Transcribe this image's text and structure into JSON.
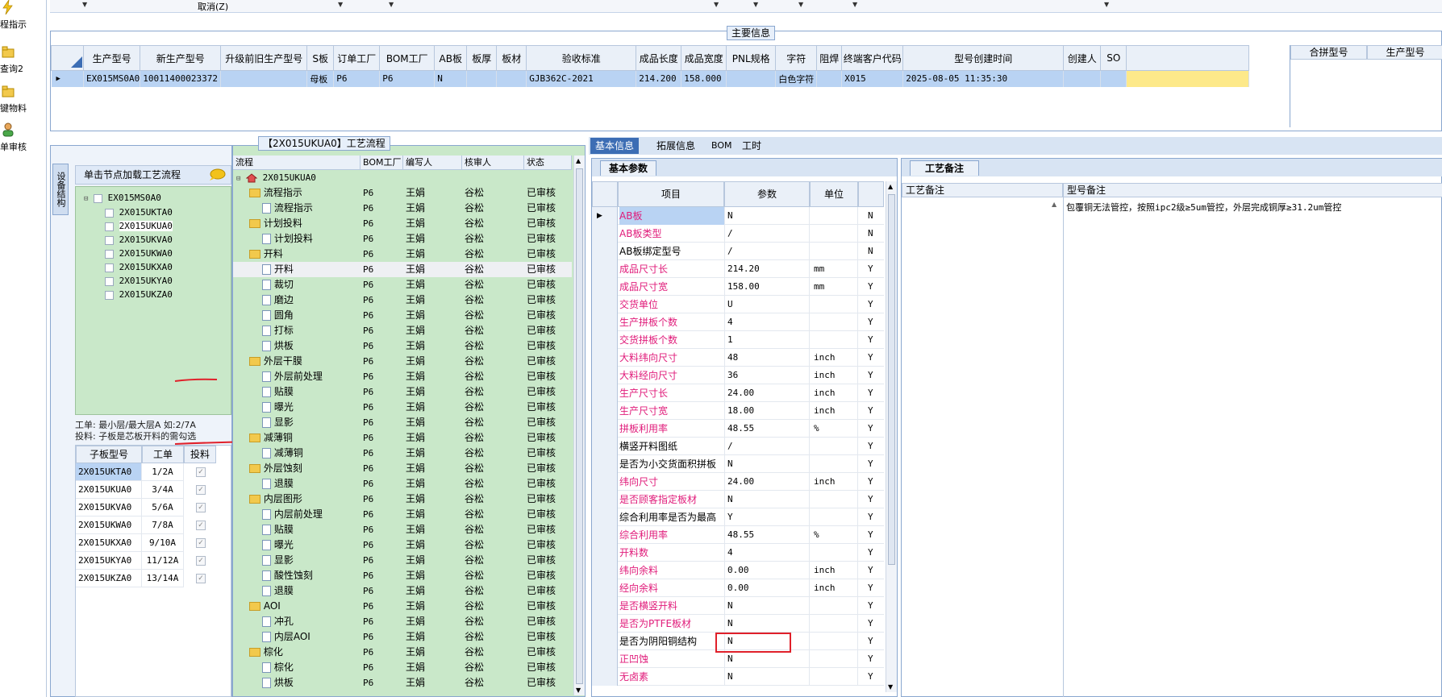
{
  "rail": {
    "items": [
      {
        "label": "程指示"
      },
      {
        "label": "查询2"
      },
      {
        "label": "键物料"
      },
      {
        "label": "单审核"
      }
    ]
  },
  "topbar": {
    "cancel_label": "取消(Z)"
  },
  "main_info": {
    "title": "主要信息",
    "columns": [
      "生产型号",
      "新生产型号",
      "升级前旧生产型号",
      "S板",
      "订单工厂",
      "BOM工厂",
      "AB板",
      "板厚",
      "板材",
      "验收标准",
      "成品长度",
      "成品宽度",
      "PNL规格",
      "字符",
      "阻焊",
      "终端客户代码",
      "型号创建时间",
      "创建人",
      "SO"
    ],
    "row": [
      "EX015MS0A0",
      "10011400023372",
      "",
      "母板",
      "P6",
      "P6",
      "N",
      "",
      "",
      "GJB362C-2021",
      "214.200",
      "158.000",
      "",
      "白色字符",
      "",
      "X015",
      "2025-08-05 11:35:30",
      "",
      ""
    ],
    "right_columns": [
      "合拼型号",
      "生产型号"
    ]
  },
  "left_panel": {
    "side_tab": "设备结构",
    "header": "单击节点加载工艺流程",
    "tree_root": "EX015MS0A0",
    "tree_children": [
      "2X015UKTA0",
      "2X015UKUA0",
      "2X015UKVA0",
      "2X015UKWA0",
      "2X015UKXA0",
      "2X015UKYA0",
      "2X015UKZA0"
    ],
    "note_line1": "工单: 最小层/最大层A 如:2/7A",
    "note_line2": "投料: 子板是芯板开料的需勾选",
    "sub_columns": [
      "子板型号",
      "工单",
      "投料"
    ],
    "sub_rows": [
      {
        "model": "2X015UKTA0",
        "order": "1/2A"
      },
      {
        "model": "2X015UKUA0",
        "order": "3/4A"
      },
      {
        "model": "2X015UKVA0",
        "order": "5/6A"
      },
      {
        "model": "2X015UKWA0",
        "order": "7/8A"
      },
      {
        "model": "2X015UKXA0",
        "order": "9/10A"
      },
      {
        "model": "2X015UKYA0",
        "order": "11/12A"
      },
      {
        "model": "2X015UKZA0",
        "order": "13/14A"
      }
    ]
  },
  "process": {
    "title": "【2X015UKUA0】工艺流程",
    "columns": [
      "流程",
      "BOM工厂",
      "编写人",
      "核审人",
      "状态"
    ],
    "root": "2X015UKUA0",
    "rows": [
      {
        "name": "流程指示",
        "lvl": 1,
        "factory": "P6",
        "writer": "王娟",
        "reviewer": "谷松",
        "status": "已审核"
      },
      {
        "name": "流程指示",
        "lvl": 2,
        "factory": "P6",
        "writer": "王娟",
        "reviewer": "谷松",
        "status": "已审核"
      },
      {
        "name": "计划投料",
        "lvl": 1,
        "factory": "P6",
        "writer": "王娟",
        "reviewer": "谷松",
        "status": "已审核"
      },
      {
        "name": "计划投料",
        "lvl": 2,
        "factory": "P6",
        "writer": "王娟",
        "reviewer": "谷松",
        "status": "已审核"
      },
      {
        "name": "开料",
        "lvl": 1,
        "factory": "P6",
        "writer": "王娟",
        "reviewer": "谷松",
        "status": "已审核"
      },
      {
        "name": "开料",
        "lvl": 2,
        "factory": "P6",
        "writer": "王娟",
        "reviewer": "谷松",
        "status": "已审核"
      },
      {
        "name": "裁切",
        "lvl": 2,
        "factory": "P6",
        "writer": "王娟",
        "reviewer": "谷松",
        "status": "已审核"
      },
      {
        "name": "磨边",
        "lvl": 2,
        "factory": "P6",
        "writer": "王娟",
        "reviewer": "谷松",
        "status": "已审核"
      },
      {
        "name": "圆角",
        "lvl": 2,
        "factory": "P6",
        "writer": "王娟",
        "reviewer": "谷松",
        "status": "已审核"
      },
      {
        "name": "打标",
        "lvl": 2,
        "factory": "P6",
        "writer": "王娟",
        "reviewer": "谷松",
        "status": "已审核"
      },
      {
        "name": "烘板",
        "lvl": 2,
        "factory": "P6",
        "writer": "王娟",
        "reviewer": "谷松",
        "status": "已审核"
      },
      {
        "name": "外层干膜",
        "lvl": 1,
        "factory": "P6",
        "writer": "王娟",
        "reviewer": "谷松",
        "status": "已审核"
      },
      {
        "name": "外层前处理",
        "lvl": 2,
        "factory": "P6",
        "writer": "王娟",
        "reviewer": "谷松",
        "status": "已审核"
      },
      {
        "name": "贴膜",
        "lvl": 2,
        "factory": "P6",
        "writer": "王娟",
        "reviewer": "谷松",
        "status": "已审核"
      },
      {
        "name": "曝光",
        "lvl": 2,
        "factory": "P6",
        "writer": "王娟",
        "reviewer": "谷松",
        "status": "已审核"
      },
      {
        "name": "显影",
        "lvl": 2,
        "factory": "P6",
        "writer": "王娟",
        "reviewer": "谷松",
        "status": "已审核"
      },
      {
        "name": "减薄铜",
        "lvl": 1,
        "factory": "P6",
        "writer": "王娟",
        "reviewer": "谷松",
        "status": "已审核"
      },
      {
        "name": "减薄铜",
        "lvl": 2,
        "factory": "P6",
        "writer": "王娟",
        "reviewer": "谷松",
        "status": "已审核"
      },
      {
        "name": "外层蚀刻",
        "lvl": 1,
        "factory": "P6",
        "writer": "王娟",
        "reviewer": "谷松",
        "status": "已审核"
      },
      {
        "name": "退膜",
        "lvl": 2,
        "factory": "P6",
        "writer": "王娟",
        "reviewer": "谷松",
        "status": "已审核"
      },
      {
        "name": "内层图形",
        "lvl": 1,
        "factory": "P6",
        "writer": "王娟",
        "reviewer": "谷松",
        "status": "已审核"
      },
      {
        "name": "内层前处理",
        "lvl": 2,
        "factory": "P6",
        "writer": "王娟",
        "reviewer": "谷松",
        "status": "已审核"
      },
      {
        "name": "贴膜",
        "lvl": 2,
        "factory": "P6",
        "writer": "王娟",
        "reviewer": "谷松",
        "status": "已审核"
      },
      {
        "name": "曝光",
        "lvl": 2,
        "factory": "P6",
        "writer": "王娟",
        "reviewer": "谷松",
        "status": "已审核"
      },
      {
        "name": "显影",
        "lvl": 2,
        "factory": "P6",
        "writer": "王娟",
        "reviewer": "谷松",
        "status": "已审核"
      },
      {
        "name": "酸性蚀刻",
        "lvl": 2,
        "factory": "P6",
        "writer": "王娟",
        "reviewer": "谷松",
        "status": "已审核"
      },
      {
        "name": "退膜",
        "lvl": 2,
        "factory": "P6",
        "writer": "王娟",
        "reviewer": "谷松",
        "status": "已审核"
      },
      {
        "name": "AOI",
        "lvl": 1,
        "factory": "P6",
        "writer": "王娟",
        "reviewer": "谷松",
        "status": "已审核"
      },
      {
        "name": "冲孔",
        "lvl": 2,
        "factory": "P6",
        "writer": "王娟",
        "reviewer": "谷松",
        "status": "已审核"
      },
      {
        "name": "内层AOI",
        "lvl": 2,
        "factory": "P6",
        "writer": "王娟",
        "reviewer": "谷松",
        "status": "已审核"
      },
      {
        "name": "棕化",
        "lvl": 1,
        "factory": "P6",
        "writer": "王娟",
        "reviewer": "谷松",
        "status": "已审核"
      },
      {
        "name": "棕化",
        "lvl": 2,
        "factory": "P6",
        "writer": "王娟",
        "reviewer": "谷松",
        "status": "已审核"
      },
      {
        "name": "烘板",
        "lvl": 2,
        "factory": "P6",
        "writer": "王娟",
        "reviewer": "谷松",
        "status": "已审核"
      }
    ]
  },
  "info_tabs": [
    "基本信息",
    "拓展信息",
    "BOM",
    "工时"
  ],
  "basic": {
    "tab": "基本参数",
    "columns": [
      "项目",
      "参数",
      "单位"
    ],
    "rows": [
      {
        "item": "AB板",
        "value": "N",
        "unit": "",
        "flag": "N",
        "pink": true
      },
      {
        "item": "AB板类型",
        "value": "/",
        "unit": "",
        "flag": "N",
        "pink": true
      },
      {
        "item": "AB板绑定型号",
        "value": "/",
        "unit": "",
        "flag": "N",
        "pink": false
      },
      {
        "item": "成品尺寸长",
        "value": "214.20",
        "unit": "mm",
        "flag": "Y",
        "pink": true
      },
      {
        "item": "成品尺寸宽",
        "value": "158.00",
        "unit": "mm",
        "flag": "Y",
        "pink": true
      },
      {
        "item": "交货单位",
        "value": "U",
        "unit": "",
        "flag": "Y",
        "pink": true
      },
      {
        "item": "生产拼板个数",
        "value": "4",
        "unit": "",
        "flag": "Y",
        "pink": true
      },
      {
        "item": "交货拼板个数",
        "value": "1",
        "unit": "",
        "flag": "Y",
        "pink": true
      },
      {
        "item": "大料纬向尺寸",
        "value": "48",
        "unit": "inch",
        "flag": "Y",
        "pink": true
      },
      {
        "item": "大料经向尺寸",
        "value": "36",
        "unit": "inch",
        "flag": "Y",
        "pink": true
      },
      {
        "item": "生产尺寸长",
        "value": "24.00",
        "unit": "inch",
        "flag": "Y",
        "pink": true
      },
      {
        "item": "生产尺寸宽",
        "value": "18.00",
        "unit": "inch",
        "flag": "Y",
        "pink": true
      },
      {
        "item": "拼板利用率",
        "value": "48.55",
        "unit": "%",
        "flag": "Y",
        "pink": true
      },
      {
        "item": "横竖开料图纸",
        "value": "/",
        "unit": "",
        "flag": "Y",
        "pink": false
      },
      {
        "item": "是否为小交货面积拼板",
        "value": "N",
        "unit": "",
        "flag": "Y",
        "pink": false
      },
      {
        "item": "纬向尺寸",
        "value": "24.00",
        "unit": "inch",
        "flag": "Y",
        "pink": true
      },
      {
        "item": "是否顾客指定板材",
        "value": "N",
        "unit": "",
        "flag": "Y",
        "pink": true
      },
      {
        "item": "综合利用率是否为最高",
        "value": "Y",
        "unit": "",
        "flag": "Y",
        "pink": false
      },
      {
        "item": "综合利用率",
        "value": "48.55",
        "unit": "%",
        "flag": "Y",
        "pink": true
      },
      {
        "item": "开料数",
        "value": "4",
        "unit": "",
        "flag": "Y",
        "pink": true
      },
      {
        "item": "纬向余料",
        "value": "0.00",
        "unit": "inch",
        "flag": "Y",
        "pink": true
      },
      {
        "item": "经向余料",
        "value": "0.00",
        "unit": "inch",
        "flag": "Y",
        "pink": true
      },
      {
        "item": "是否横竖开料",
        "value": "N",
        "unit": "",
        "flag": "Y",
        "pink": true
      },
      {
        "item": "是否为PTFE板材",
        "value": "N",
        "unit": "",
        "flag": "Y",
        "pink": true
      },
      {
        "item": "是否为阴阳铜结构",
        "value": "N",
        "unit": "",
        "flag": "Y",
        "pink": false
      },
      {
        "item": "正凹蚀",
        "value": "N",
        "unit": "",
        "flag": "Y",
        "pink": true
      },
      {
        "item": "无卤素",
        "value": "N",
        "unit": "",
        "flag": "Y",
        "pink": true
      }
    ]
  },
  "notes": {
    "tab": "工艺备注",
    "col1": "工艺备注",
    "col2": "型号备注",
    "model_note": "包覆铜无法管控，按照ipc2级≥5um管控，外层完成铜厚≥31.2um管控"
  },
  "colors": {
    "accent": "#3c6db4",
    "pink": "#e01b7a",
    "tree_bg": "#c9e8c9",
    "selected": "#b9d3f3",
    "highlight": "#fde98a"
  }
}
